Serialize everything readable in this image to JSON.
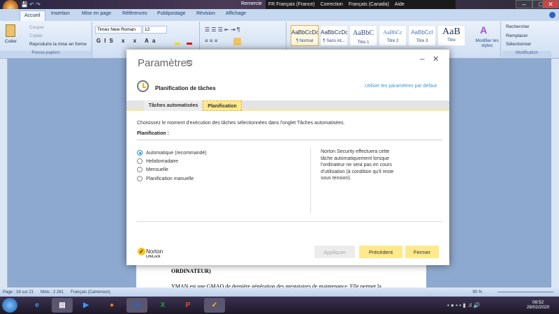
{
  "word": {
    "title_fragment": "Remercie",
    "langbar": [
      "FR Français (France)",
      "Correction",
      "Français (Canada)",
      "Aide"
    ],
    "tabs": [
      "Accueil",
      "Insertion",
      "Mise en page",
      "Références",
      "Publipostage",
      "Révision",
      "Affichage"
    ],
    "clipboard": {
      "paste": "Coller",
      "cut": "Couper",
      "copy": "Copier",
      "format_painter": "Reproduire la mise en forme",
      "group": "Presse-papiers"
    },
    "font": {
      "name": "Times New Roman",
      "size": "12"
    },
    "styles": [
      {
        "preview": "AaBbCcDc",
        "label": "¶ Normal"
      },
      {
        "preview": "AaBbCcDc",
        "label": "¶ Sans int..."
      },
      {
        "preview": "AaBbC",
        "label": "Titre 1"
      },
      {
        "preview": "AaBbCc",
        "label": "Titre 2"
      },
      {
        "preview": "AaBbCcI",
        "label": "Titre 3"
      },
      {
        "preview": "AaB",
        "label": "Titre"
      }
    ],
    "modify_styles": "Modifier les styles",
    "editing": {
      "find": "Rechercher",
      "replace": "Remplacer",
      "select": "Sélectionner",
      "group": "Modification"
    },
    "doc_heading": "ORDINATEUR)",
    "doc_text": "YMAN est une GMAO de dernière génération des prestataires de maintenance. Elle permet la",
    "status": {
      "page": "Page : 16 sur 21",
      "words": "Mots : 2 261",
      "language": "Français (Cameroun)",
      "zoom": "90 %"
    }
  },
  "dialog": {
    "title": "Paramètres",
    "help": "?",
    "section_title": "Planification de tâches",
    "default_link": "Utiliser les paramètres par défaut",
    "tabs": [
      "Tâches automatisées",
      "Planification"
    ],
    "description": "Choisissez le moment d'exécution des tâches sélectionnées dans l'onglet Tâches automatisées.",
    "schedule_label": "Planification :",
    "options": [
      "Automatique (recommandé)",
      "Hebdomadaire",
      "Mensuelle",
      "Planification manuelle"
    ],
    "selected_option": "Automatique (recommandé)",
    "info": [
      "Norton Security effectuera cette",
      "tâche automatiquement lorsque",
      "l'ordinateur ne sera pas en cours",
      "d'utilisation (à condition qu'il reste",
      "sous tension)."
    ],
    "brand": "Norton",
    "brand_sub": "LifeLock",
    "buttons": {
      "apply": "Appliquer",
      "previous": "Précédent",
      "close": "Fermer"
    }
  },
  "taskbar": {
    "time": "08:52",
    "date": "28/02/2020"
  },
  "colors": {
    "accent_yellow": "#ffe98a",
    "link": "#3a9ad9"
  }
}
